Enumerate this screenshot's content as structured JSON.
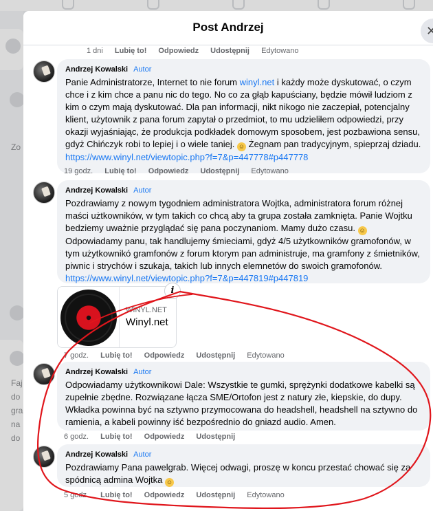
{
  "modal": {
    "title": "Post Andrzej",
    "close_icon": "close-icon"
  },
  "background": {
    "left_text_1": "Zo",
    "left_text_2": "Faj",
    "left_text_3": "do",
    "left_text_4": "gra",
    "left_text_5": "na",
    "left_text_6": "do"
  },
  "top_actions": {
    "time": "1 dni",
    "like": "Lubię to!",
    "reply": "Odpowiedz",
    "share": "Udostępnij",
    "edited": "Edytowano"
  },
  "comments": [
    {
      "author": "Andrzej Kowalski",
      "badge": "Autor",
      "text": "Panie Administratorze, Internet to nie forum ",
      "text_link": "winyl.net",
      "text_cont": " i każdy może dyskutować, o czym chce i z kim chce a panu nic do tego. No co za głąb kapuściany, będzie mówił ludziom z kim o czym mają dyskutować. Dla pan informacji, nikt nikogo nie zaczepiał, potencjalny klient, użytownik z pana forum zapytał o przedmiot, to mu udzieliłem odpowiedzi, przy okazji wyjaśniając, że produkcja podkładek domowym sposobem, jest pozbawiona sensu, gdyż Chińczyk robi to lepiej i o wiele taniej. ",
      "text_end": " Żegnam pan tradycyjnym, spieprzaj dziadu. ",
      "url": "https://www.winyl.net/viewtopic.php?f=7&p=447778#p447778",
      "time": "19 godz.",
      "like": "Lubię to!",
      "reply": "Odpowiedz",
      "share": "Udostępnij",
      "edited": "Edytowano"
    },
    {
      "author": "Andrzej Kowalski",
      "badge": "Autor",
      "text": "Pozdrawiamy z nowym tygodniem administratora Wojtka, administratora forum różnej maści użtkowników, w tym takich co chcą aby ta grupa została zamknięta. Panie Wojtku bedziemy uważnie przyglądać się pana poczynaniom. Mamy dużo czasu. ",
      "text_end": " Odpowiadamy panu, tak handlujemy śmieciami, gdyż 4/5 użytkowników gramofonów, w tym użytkownikó gramfonów z forum ktorym pan administruje, ma gramfony z śmietników, piwnic i strychów i szukaja, takich lub innych elemnetów do swoich gramofonów. ",
      "url": "https://www.winyl.net/viewtopic.php?f=7&p=447819#p447819",
      "preview_domain": "WINYL.NET",
      "preview_title": "Winyl.net",
      "time": "7 godz.",
      "like": "Lubię to!",
      "reply": "Odpowiedz",
      "share": "Udostępnij",
      "edited": "Edytowano"
    },
    {
      "author": "Andrzej Kowalski",
      "badge": "Autor",
      "text": "Odpowiadamy użytkownikowi Dale: Wszystkie te gumki, sprężynki dodatkowe kabelki są zupełnie zbędne. Rozwiązane łącza SME/Ortofon jest z natury złe, kiepskie, do dupy. Wkładka powinna być na sztywno przymocowana do headshell, headshell na sztywno do ramienia, a kabeli powinny iść bezpośrednio do gniazd audio. Amen.",
      "time": "6 godz.",
      "like": "Lubię to!",
      "reply": "Odpowiedz",
      "share": "Udostępnij"
    },
    {
      "author": "Andrzej Kowalski",
      "badge": "Autor",
      "text": "Pozdrawiamy Pana pawelgrab. Więcej odwagi, proszę w koncu przestać chować się za spódnicą admina Wojtka ",
      "time": "5 godz.",
      "like": "Lubię to!",
      "reply": "Odpowiedz",
      "share": "Udostępnij",
      "edited": "Edytowano"
    }
  ],
  "colors": {
    "link": "#1877f2",
    "bubble": "#f0f2f5",
    "annotation": "#e0161c"
  }
}
